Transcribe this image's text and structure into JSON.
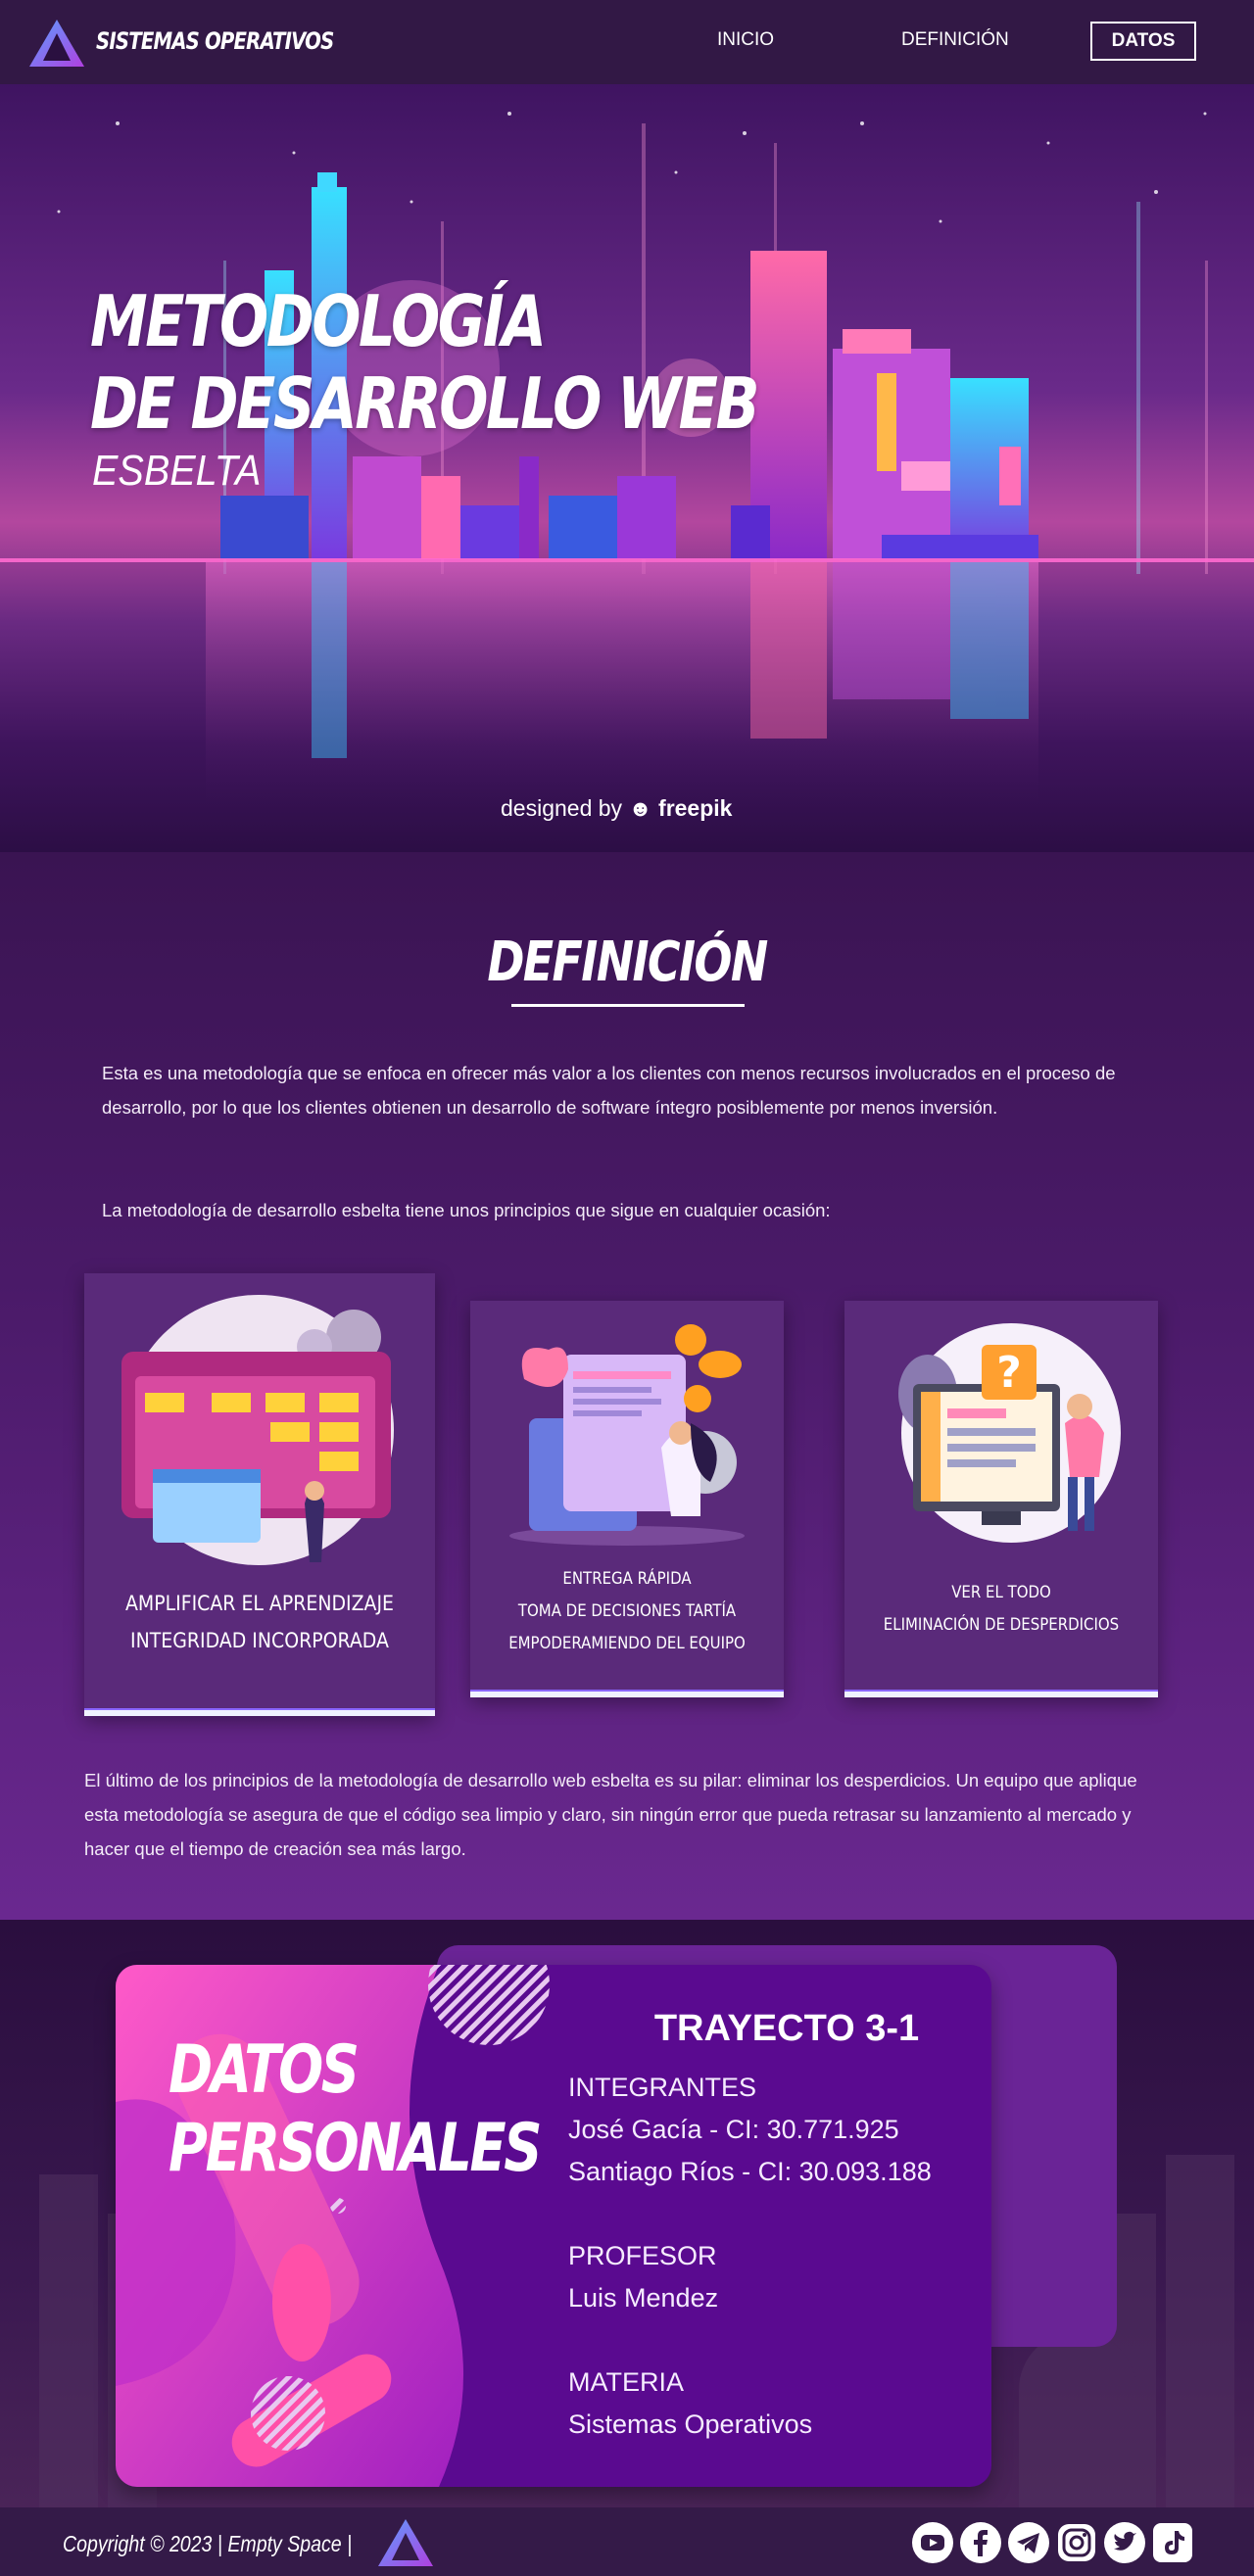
{
  "nav": {
    "brand": "SISTEMAS OPERATIVOS",
    "links": [
      "INICIO",
      "DEFINICIÓN"
    ],
    "cta": "DATOS"
  },
  "hero": {
    "title_line1": "METODOLOGÍA",
    "title_line2": "DE DESARROLLO WEB",
    "subtitle": "ESBELTA",
    "credit_prefix": "designed by",
    "credit_brand": "freepik"
  },
  "definition": {
    "title": "DEFINICIÓN",
    "paragraph1": "Esta es una metodología que se enfoca en ofrecer más valor a los clientes con menos recursos involucrados en el proceso de desarrollo, por lo que los clientes obtienen un desarrollo de software íntegro posiblemente por menos inversión.",
    "paragraph2": "La metodología de desarrollo esbelta tiene unos principios que sigue en cualquier ocasión:",
    "cards": [
      {
        "line1": "AMPLIFICAR EL APRENDIZAJE",
        "line2": "INTEGRIDAD INCORPORADA",
        "line3": ""
      },
      {
        "line1": "ENTREGA RÁPIDA",
        "line2": "TOMA DE DECISIONES TARTÍA",
        "line3": "EMPODERAMIENDO DEL EQUIPO"
      },
      {
        "line1": "VER EL TODO",
        "line2": "ELIMINACIÓN DE DESPERDICIOS",
        "line3": ""
      }
    ],
    "paragraph3": "El último de los principios de la metodología de desarrollo web esbelta es su pilar: eliminar los desperdicios. Un equipo que aplique esta metodología se asegura de que el código sea limpio y claro, sin ningún error que pueda retrasar su lanzamiento al mercado y hacer que el tiempo de creación sea más largo."
  },
  "datos": {
    "title_line1": "DATOS",
    "title_line2": "PERSONALES",
    "trayecto": "TRAYECTO 3-1",
    "integrantes_label": "INTEGRANTES",
    "integrante1": "José Gacía - CI: 30.771.925",
    "integrante2": "Santiago Ríos - CI: 30.093.188",
    "profesor_label": "PROFESOR",
    "profesor": "Luis Mendez",
    "materia_label": "MATERIA",
    "materia": "Sistemas Operativos"
  },
  "footer": {
    "copyright": "Copyright © 2023 | Empty Space |",
    "socials": [
      "youtube-icon",
      "facebook-icon",
      "telegram-icon",
      "instagram-icon",
      "twitter-icon",
      "tiktok-icon"
    ]
  },
  "colors": {
    "nav_bg": "#321845",
    "accent_purple": "#5a0a90",
    "card_bg": "#5a2a7a",
    "footer_bg": "#341a48"
  }
}
